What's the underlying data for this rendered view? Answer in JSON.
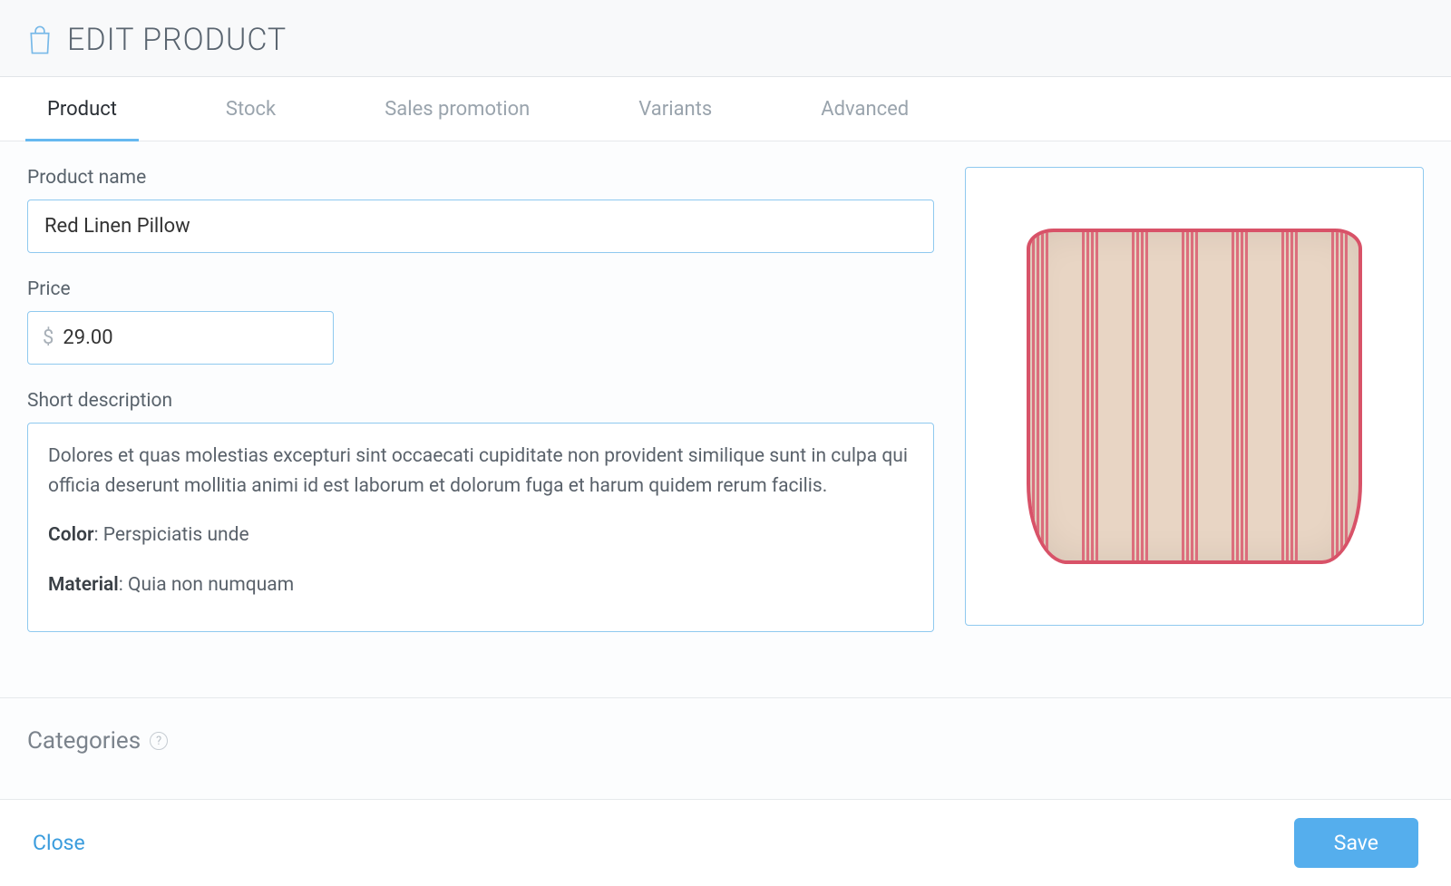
{
  "header": {
    "title": "EDIT PRODUCT"
  },
  "tabs": [
    {
      "label": "Product",
      "active": true
    },
    {
      "label": "Stock",
      "active": false
    },
    {
      "label": "Sales promotion",
      "active": false
    },
    {
      "label": "Variants",
      "active": false
    },
    {
      "label": "Advanced",
      "active": false
    }
  ],
  "fields": {
    "product_name": {
      "label": "Product name",
      "value": "Red Linen Pillow"
    },
    "price": {
      "label": "Price",
      "currency": "$",
      "value": "29.00"
    },
    "short_description": {
      "label": "Short description",
      "paragraph": "Dolores et quas molestias excepturi sint occaecati cupiditate non provident similique sunt in culpa qui officia deserunt mollitia animi id est laborum et dolorum fuga et harum quidem rerum facilis.",
      "color_label": "Color",
      "color_value": ": Perspiciatis unde",
      "material_label": "Material",
      "material_value": ": Quia non numquam"
    }
  },
  "sections": {
    "categories": "Categories"
  },
  "footer": {
    "close": "Close",
    "save": "Save"
  }
}
